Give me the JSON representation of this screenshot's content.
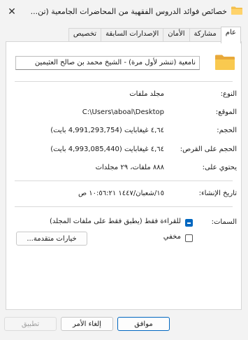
{
  "window": {
    "title": "خصائص فوائد الدروس الفقهية من المحاضرات الجامعية (تن..."
  },
  "tabs": [
    "عام",
    "مشاركة",
    "الأمان",
    "الإصدارات السابقة",
    "تخصيص"
  ],
  "active_tab": "عام",
  "file": {
    "name": "نامعية (تنشر لأول مرة) - الشيخ محمد بن صالح العثيمين"
  },
  "properties": {
    "type_label": "النوع:",
    "type_value": "مجلد ملفات",
    "location_label": "الموقع:",
    "location_value": "C:\\Users\\aboal\\Desktop",
    "size_label": "الحجم:",
    "size_value": "٤,٦٤ غيغابايت (4,991,293,754 بايت)",
    "disk_size_label": "الحجم على القرص:",
    "disk_size_value": "٤,٦٤ غيغابايت (4,993,085,440 بايت)",
    "contains_label": "يحتوي على:",
    "contains_value": "٨٨٨ ملفات، ٢٩ مجلدات",
    "created_label": "تاريخ الإنشاء:",
    "created_value": "١٥/شعبان/١٤٤٧ ١٠:٥٦:٢١ ص"
  },
  "attributes": {
    "label": "السمات:",
    "readonly_label": "للقراءة فقط (يطبق فقط على ملفات المجلد)",
    "readonly_state": "partial",
    "hidden_label": "مخفي",
    "hidden_state": "unchecked",
    "advanced_button": "خيارات متقدمة..."
  },
  "buttons": {
    "ok": "موافق",
    "cancel": "إلغاء الأمر",
    "apply": "تطبيق"
  },
  "colors": {
    "accent": "#0067c0",
    "folder": "#f4c04e"
  },
  "icons": {
    "title": "folder-icon",
    "close": "close-icon",
    "main": "folder-icon"
  }
}
